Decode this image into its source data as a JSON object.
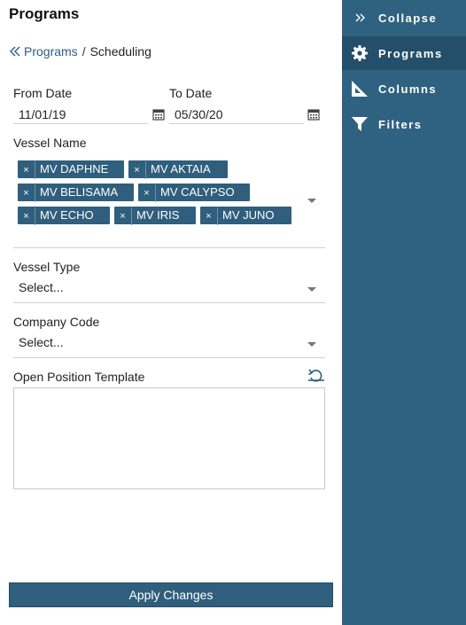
{
  "panel": {
    "title": "Programs",
    "breadcrumb": {
      "parent": "Programs",
      "separator": "/",
      "current": "Scheduling"
    }
  },
  "dates": {
    "from_label": "From Date",
    "from_value": "11/01/19",
    "to_label": "To Date",
    "to_value": "05/30/20"
  },
  "vessel_name": {
    "label": "Vessel Name",
    "selected": [
      {
        "name": "MV DAPHNE",
        "remove": "×"
      },
      {
        "name": "MV AKTAIA",
        "remove": "×"
      },
      {
        "name": "MV BELISAMA",
        "remove": "×"
      },
      {
        "name": "MV CALYPSO",
        "remove": "×"
      },
      {
        "name": "MV ECHO",
        "remove": "×"
      },
      {
        "name": "MV IRIS",
        "remove": "×"
      },
      {
        "name": "MV JUNO",
        "remove": "×"
      }
    ]
  },
  "vessel_type": {
    "label": "Vessel Type",
    "value": "Select..."
  },
  "company_code": {
    "label": "Company Code",
    "value": "Select..."
  },
  "open_position": {
    "label": "Open Position Template",
    "value": ""
  },
  "apply_button": "Apply Changes",
  "sidebar": {
    "items": [
      {
        "label": "Collapse",
        "icon": "double-chevron-right-icon"
      },
      {
        "label": "Programs",
        "icon": "gear-icon",
        "active": true
      },
      {
        "label": "Columns",
        "icon": "set-square-icon"
      },
      {
        "label": "Filters",
        "icon": "funnel-icon"
      }
    ]
  },
  "colors": {
    "accent": "#2f5f7c",
    "sidebar_bg": "#2f6280",
    "sidebar_active": "#244f6b",
    "link": "#2c5d7c"
  }
}
